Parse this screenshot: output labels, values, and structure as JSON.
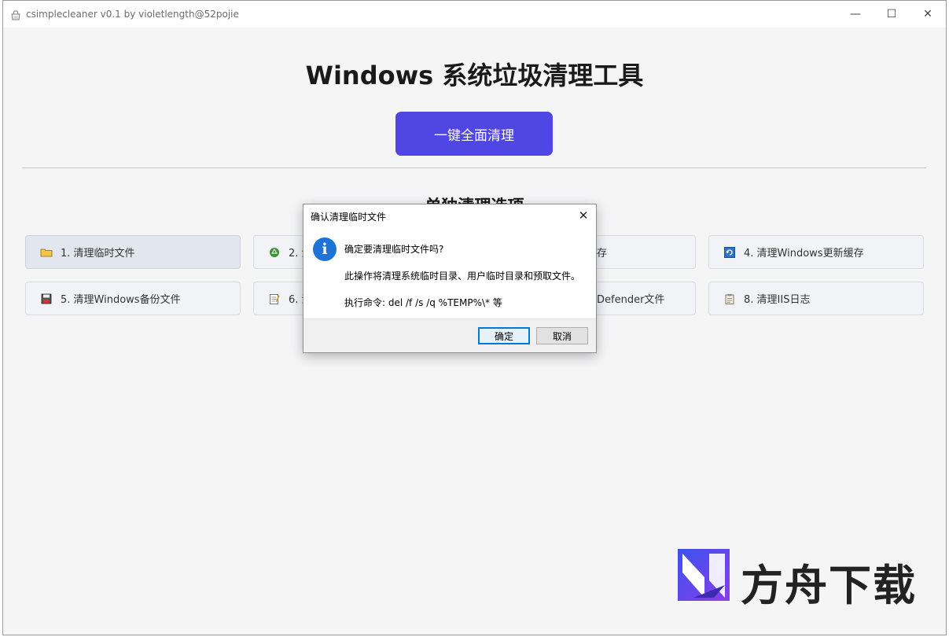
{
  "window": {
    "title": "csimplecleaner v0.1 by violetlength@52pojie",
    "controls": {
      "minimize": "—",
      "maximize": "☐",
      "close": "✕"
    }
  },
  "main": {
    "title": "Windows 系统垃圾清理工具",
    "all_clean_label": "一键全面清理",
    "section_title": "单独清理选项"
  },
  "options": [
    {
      "label": "1. 清理临时文件",
      "icon": "folder-icon"
    },
    {
      "label": "2. 清",
      "icon": "recycle-icon"
    },
    {
      "label": "存",
      "icon": ""
    },
    {
      "label": "4. 清理Windows更新缓存",
      "icon": "update-icon"
    },
    {
      "label": "5. 清理Windows备份文件",
      "icon": "floppy-icon"
    },
    {
      "label": "6. 清",
      "icon": "notepad-icon"
    },
    {
      "label": "Defender文件",
      "icon": ""
    },
    {
      "label": "8. 清理IIS日志",
      "icon": "clipboard-icon"
    }
  ],
  "dialog": {
    "title": "确认清理临时文件",
    "close": "✕",
    "line1": "确定要清理临时文件吗?",
    "line2": "此操作将清理系统临时目录、用户临时目录和预取文件。",
    "line3": "执行命令: del /f /s /q %TEMP%\\* 等",
    "ok_label": "确定",
    "cancel_label": "取消"
  },
  "watermark": {
    "text": "方舟下载"
  },
  "colors": {
    "accent": "#5046e4",
    "info": "#1e73d8",
    "dialog_primary_border": "#0078d7"
  }
}
